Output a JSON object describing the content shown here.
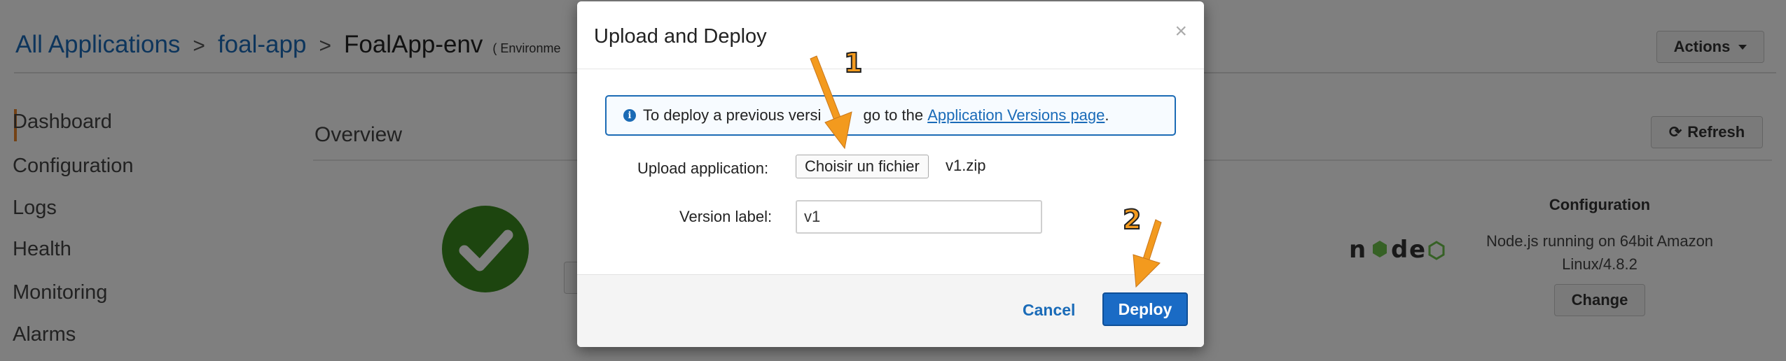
{
  "breadcrumb": {
    "items": [
      "All Applications",
      "foal-app"
    ],
    "separator": ">",
    "current": "FoalApp-env",
    "sub": "( Environme"
  },
  "header": {
    "actions_label": "Actions"
  },
  "sidebar": {
    "items": [
      {
        "label": "Dashboard",
        "active": true
      },
      {
        "label": "Configuration"
      },
      {
        "label": "Logs"
      },
      {
        "label": "Health"
      },
      {
        "label": "Monitoring"
      },
      {
        "label": "Alarms"
      }
    ]
  },
  "overview": {
    "title": "Overview",
    "refresh_label": "Refresh"
  },
  "configuration": {
    "heading": "Configuration",
    "description": "Node.js running on 64bit Amazon Linux/4.8.2",
    "change_label": "Change"
  },
  "modal": {
    "title": "Upload and Deploy",
    "close_symbol": "×",
    "info_before": "To deploy a previous versi",
    "info_middle": " go to the ",
    "info_link": "Application Versions page",
    "info_after": ".",
    "upload_label": "Upload application:",
    "file_button": "Choisir un fichier",
    "file_name": "v1.zip",
    "version_label": "Version label:",
    "version_value": "v1",
    "cancel_label": "Cancel",
    "deploy_label": "Deploy"
  },
  "annotations": {
    "step1": "1",
    "step2": "2"
  },
  "colors": {
    "link": "#1a6bb8",
    "primary_button": "#1a6bc5",
    "health_ok": "#3a8a1f",
    "annotation": "#f39a1e",
    "active_tab": "#e8852b"
  },
  "icons": {
    "info": "info-circle-icon",
    "refresh": "refresh-icon",
    "health": "check-circle-icon",
    "close": "close-icon",
    "logo": "nodejs-logo"
  }
}
